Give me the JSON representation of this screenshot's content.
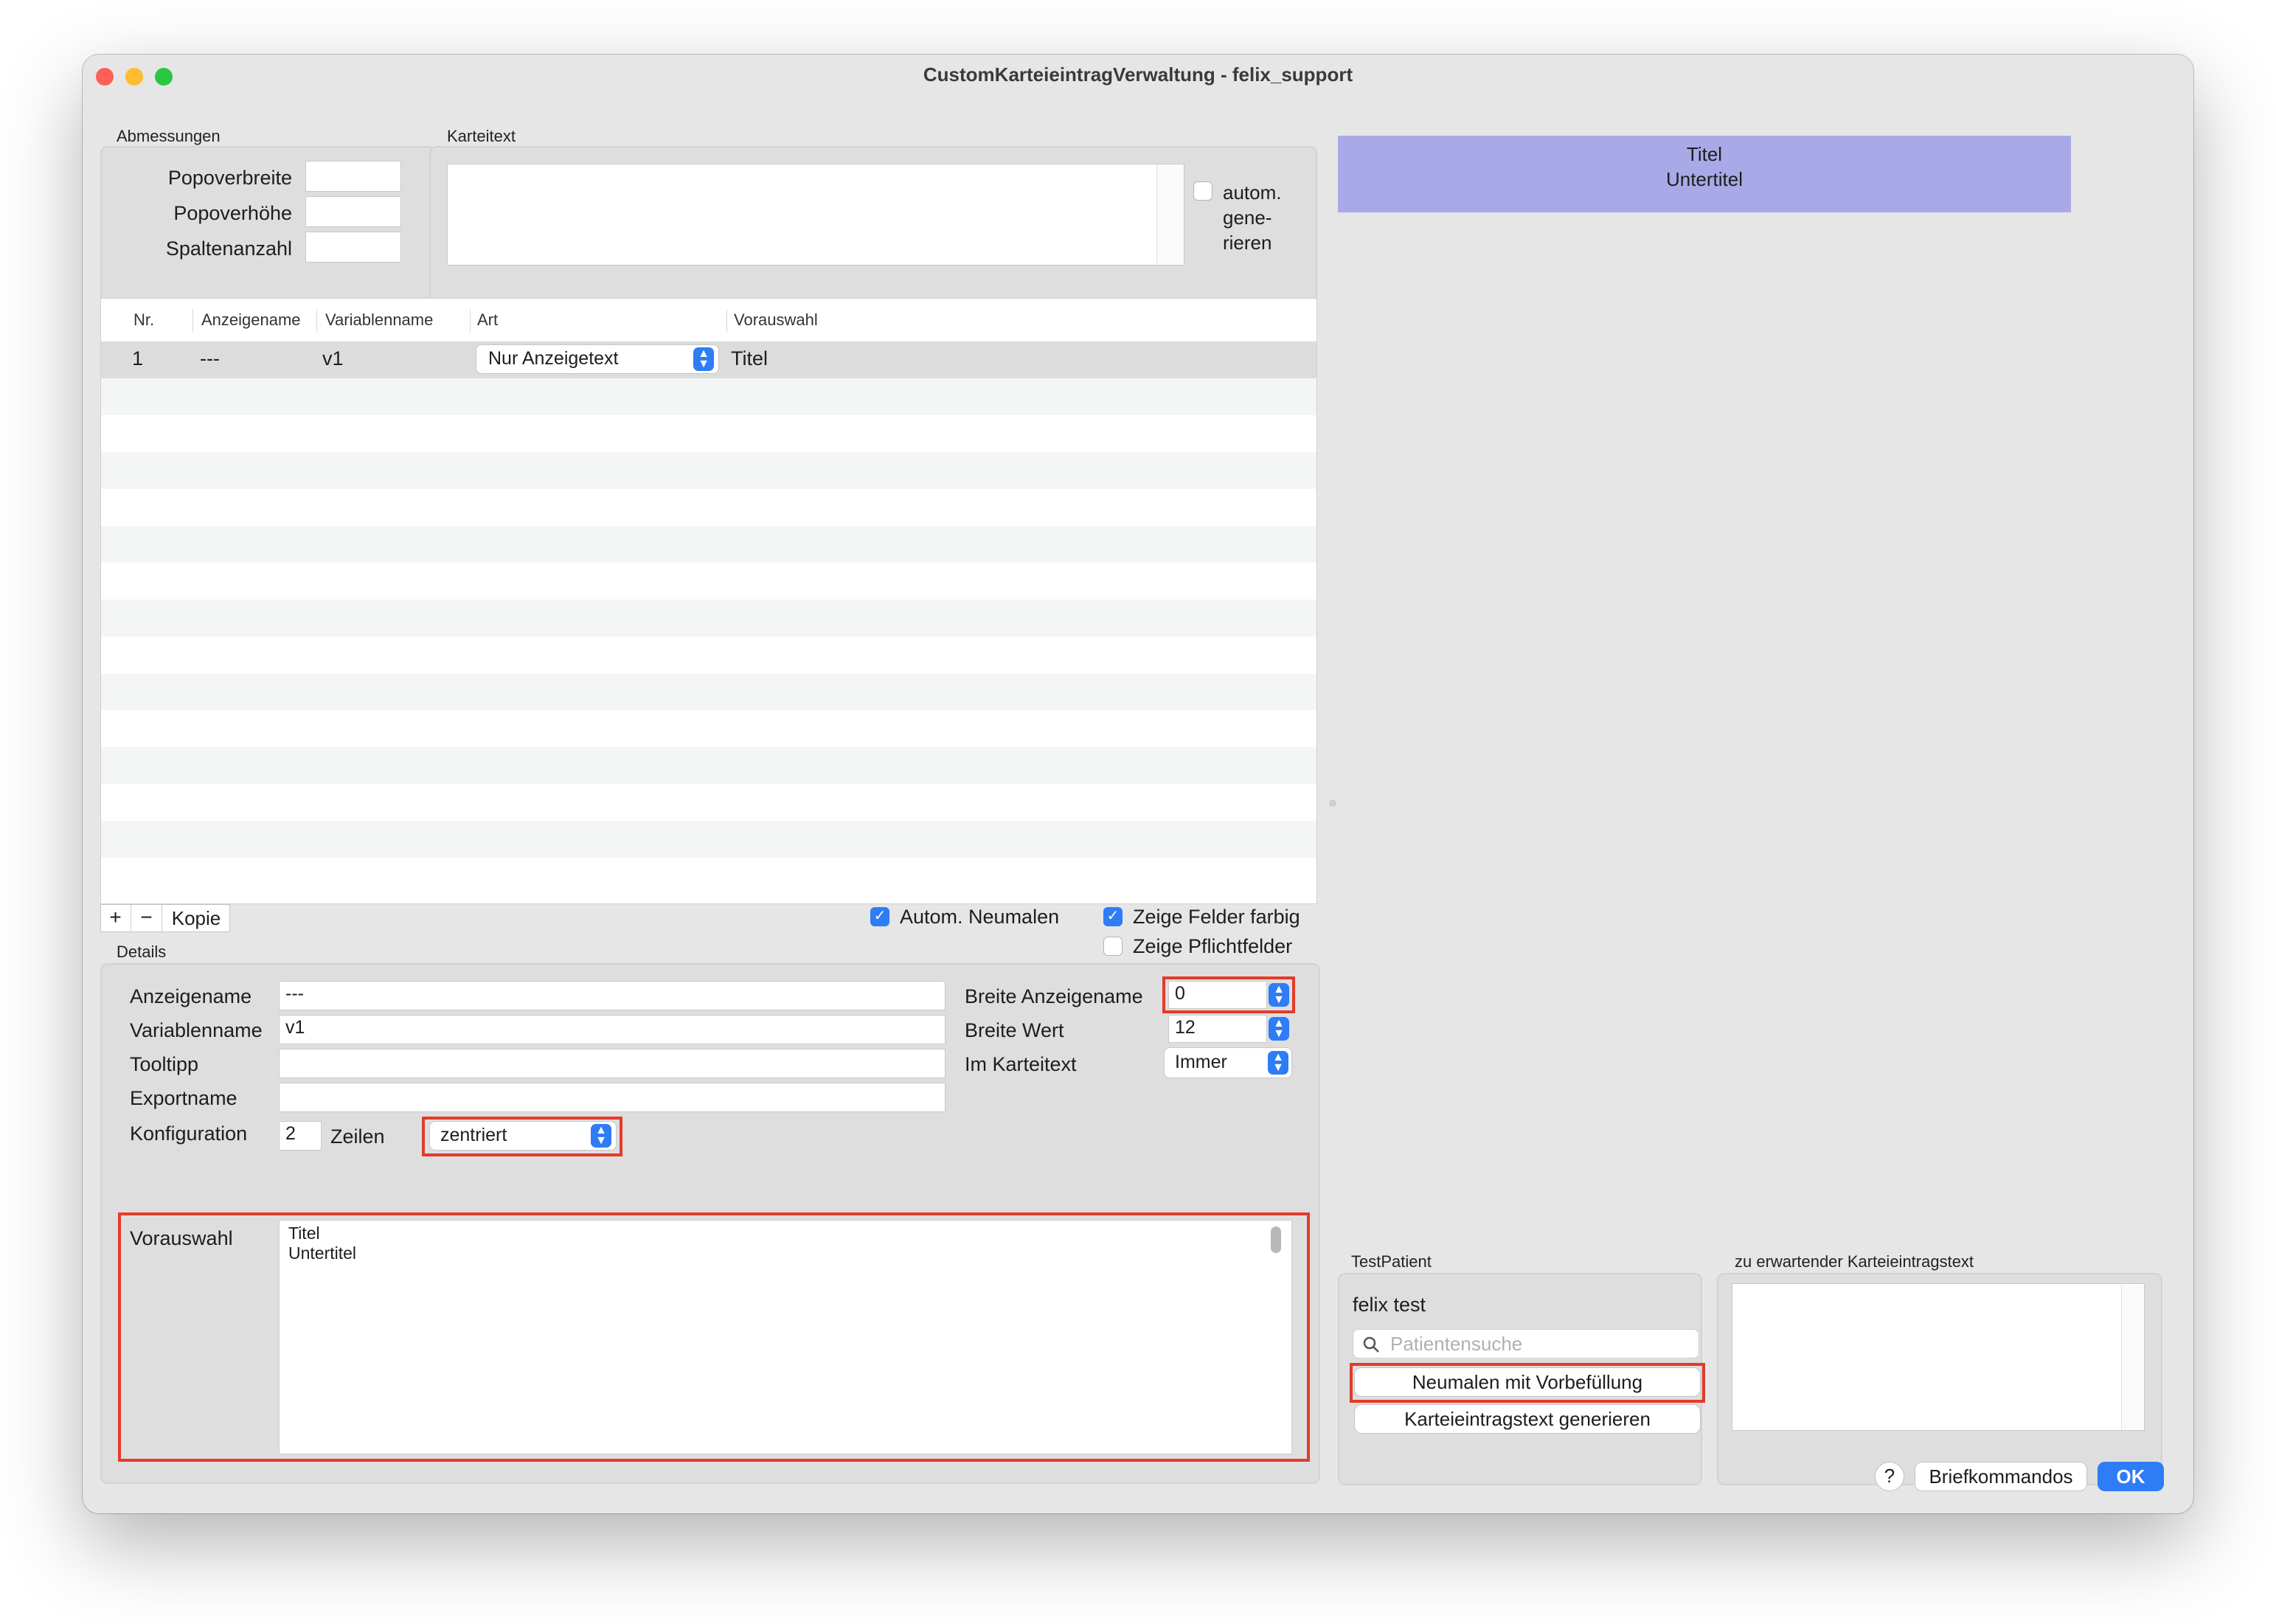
{
  "window": {
    "title": "CustomKarteieintragVerwaltung - felix_support"
  },
  "abmessungen": {
    "group_label": "Abmessungen",
    "popoverbreite_label": "Popoverbreite",
    "popoverhoehe_label": "Popoverhöhe",
    "spaltenanzahl_label": "Spaltenanzahl",
    "popoverbreite_value": "",
    "popoverhoehe_value": "",
    "spaltenanzahl_value": ""
  },
  "karteitext": {
    "group_label": "Karteitext",
    "text": "",
    "autom_line1": "autom.",
    "autom_line2": "gene-",
    "autom_line3": "rieren",
    "autom_checked": false
  },
  "table": {
    "headers": [
      "Nr.",
      "Anzeigename",
      "Variablenname",
      "Art",
      "Vorauswahl"
    ],
    "rows": [
      {
        "nr": "1",
        "anzeigename": "---",
        "variablenname": "v1",
        "art": "Nur Anzeigetext",
        "vorauswahl": "Titel"
      }
    ]
  },
  "table_toolbar": {
    "add": "+",
    "remove": "−",
    "kopie": "Kopie",
    "autom_neumalen": "Autom. Neumalen",
    "autom_neumalen_checked": true,
    "zeige_felder_farbig": "Zeige Felder farbig",
    "zeige_felder_farbig_checked": true,
    "zeige_pflichtfelder": "Zeige Pflichtfelder",
    "zeige_pflichtfelder_checked": false
  },
  "details": {
    "group_label": "Details",
    "anzeigename_label": "Anzeigename",
    "anzeigename_value": "---",
    "variablenname_label": "Variablenname",
    "variablenname_value": "v1",
    "tooltipp_label": "Tooltipp",
    "tooltipp_value": "",
    "exportname_label": "Exportname",
    "exportname_value": "",
    "konfiguration_label": "Konfiguration",
    "zeilen_value": "2",
    "zeilen_label": "Zeilen",
    "ausrichtung_value": "zentriert",
    "breite_anzeigename_label": "Breite Anzeigename",
    "breite_anzeigename_value": "0",
    "breite_wert_label": "Breite Wert",
    "breite_wert_value": "12",
    "im_karteitext_label": "Im Karteitext",
    "im_karteitext_value": "Immer",
    "vorauswahl_label": "Vorauswahl",
    "vorauswahl_line1": "Titel",
    "vorauswahl_line2": "Untertitel"
  },
  "preview": {
    "line1": "Titel",
    "line2": "Untertitel",
    "background_color": "#a9a9e8"
  },
  "testpatient": {
    "group_label": "TestPatient",
    "name": "felix test",
    "search_placeholder": "Patientensuche",
    "neumalen_button": "Neumalen mit Vorbefüllung",
    "generieren_button": "Karteieintragstext generieren"
  },
  "erwartet": {
    "group_label": "zu erwartender Karteieintragstext",
    "text": ""
  },
  "footer": {
    "help": "?",
    "briefkommandos": "Briefkommandos",
    "ok": "OK"
  },
  "colors": {
    "accent": "#2e7cf6",
    "highlight_red": "#e33b2a",
    "close": "#ff5f57",
    "minimize": "#febc2e",
    "zoom": "#28c840"
  }
}
